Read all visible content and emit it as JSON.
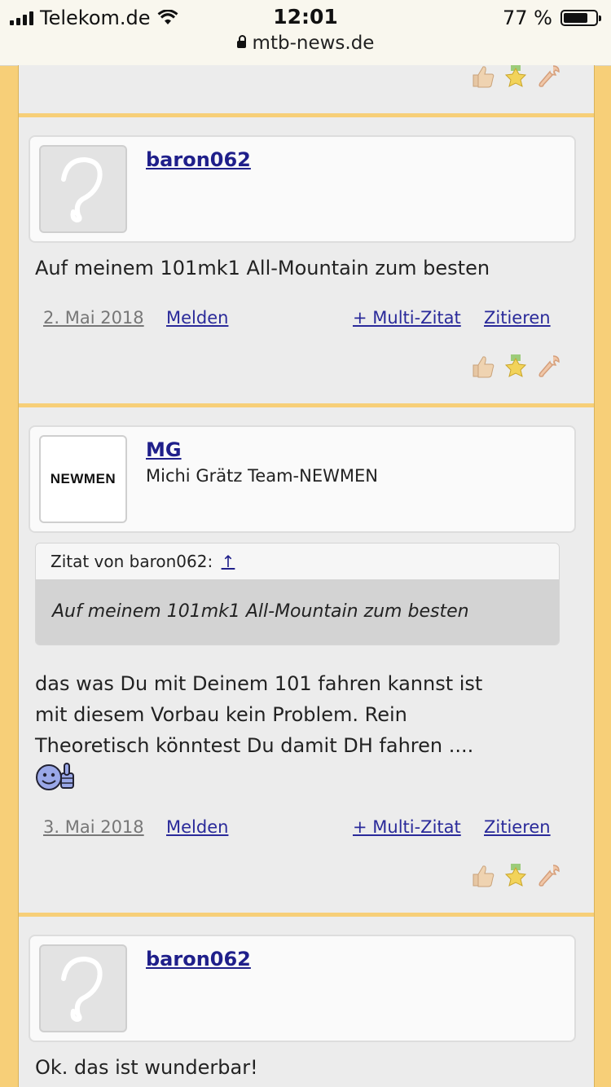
{
  "status": {
    "carrier": "Telekom.de",
    "time": "12:01",
    "battery": "77 %",
    "url": "mtb-news.de",
    "battery_level": 0.77
  },
  "posts": [
    {
      "username": "baron062",
      "title": "",
      "avatar": "default-avatar",
      "message": "Auf meinem 101mk1 All-Mountain zum besten",
      "date": "2. Mai 2018",
      "report": "Melden",
      "multiquote": "+ Multi-Zitat",
      "quote": "Zitieren"
    },
    {
      "username": "MG",
      "title": "Michi Grätz Team-NEWMEN",
      "avatar": "newmen-logo",
      "avatar_text": "NEWMEN",
      "quote_block": {
        "header": "Zitat von baron062:",
        "arrow": "↑",
        "text": "Auf meinem 101mk1 All-Mountain zum besten"
      },
      "message_lines": [
        "das was Du mit Deinem 101 fahren kannst ist",
        "mit diesem Vorbau kein Problem. Rein",
        "Theoretisch könntest Du damit DH fahren ...."
      ],
      "date": "3. Mai 2018",
      "report": "Melden",
      "multiquote": "+ Multi-Zitat",
      "quote": "Zitieren"
    },
    {
      "username": "baron062",
      "title": "",
      "avatar": "default-avatar",
      "message": "Ok. das ist wunderbar!"
    }
  ],
  "reactions": [
    "thumbs-up-icon",
    "star-award-icon",
    "wrench-icon"
  ]
}
